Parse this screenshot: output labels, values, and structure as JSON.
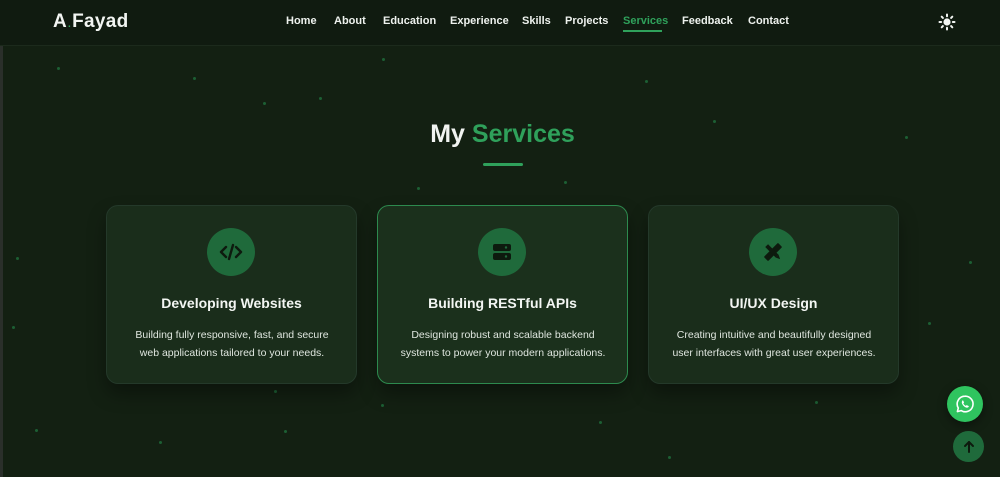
{
  "brand": {
    "logo_first": "A",
    "logo_last": "Fayad",
    "accent_color": "#2fa15b"
  },
  "nav": {
    "items": [
      {
        "label": "Home"
      },
      {
        "label": "About"
      },
      {
        "label": "Education"
      },
      {
        "label": "Experience"
      },
      {
        "label": "Skills"
      },
      {
        "label": "Projects"
      },
      {
        "label": "Services",
        "active": true
      },
      {
        "label": "Feedback"
      },
      {
        "label": "Contact"
      }
    ],
    "theme_toggle_icon": "sun-icon"
  },
  "services": {
    "heading_plain": "My",
    "heading_accent": "Services",
    "cards": [
      {
        "icon": "code-icon",
        "title": "Developing Websites",
        "desc_line1": "Building fully responsive, fast, and secure",
        "desc_line2": "web applications tailored to your needs."
      },
      {
        "icon": "server-icon",
        "title": "Building RESTful APIs",
        "desc_line1": "Designing robust and scalable backend",
        "desc_line2": "systems to power your modern applications."
      },
      {
        "icon": "pen-ruler-icon",
        "title": "UI/UX Design",
        "desc_line1": "Creating intuitive and beautifully designed",
        "desc_line2": "user interfaces with great user experiences."
      }
    ]
  },
  "floating": {
    "whatsapp_icon": "whatsapp-icon",
    "scroll_top_icon": "arrow-up-icon"
  }
}
